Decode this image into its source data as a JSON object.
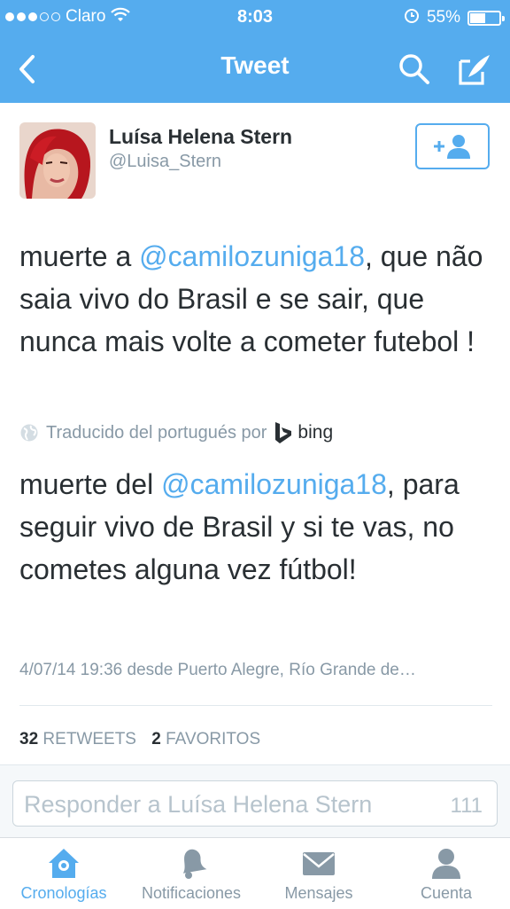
{
  "status_bar": {
    "carrier": "Claro",
    "time": "8:03",
    "battery": "55%",
    "battery_level": 0.55,
    "signal_bars": 3,
    "signal_max": 5
  },
  "nav": {
    "title": "Tweet"
  },
  "tweet": {
    "author_name": "Luísa Helena Stern",
    "author_handle": "@Luisa_Stern",
    "text_before": "muerte a ",
    "mention": "@camilozuniga18",
    "text_after": ", que não saia vivo do Brasil e se sair, que nunca mais volte a cometer futebol !",
    "translation_label": "Traducido del portugués por",
    "translation_provider": "bing",
    "translated_before": "muerte del ",
    "translated_mention": "@camilozuniga18",
    "translated_after": ", para seguir vivo de Brasil y si te vas, no cometes alguna vez fútbol!",
    "meta": "4/07/14 19:36 desde Puerto Alegre, Río Grande de…",
    "retweets_count": "32",
    "retweets_label": "RETWEETS",
    "favorites_count": "2",
    "favorites_label": "FAVORITOS"
  },
  "reply": {
    "placeholder": "Responder a Luísa Helena Stern",
    "char_count": "111"
  },
  "tabs": [
    {
      "label": "Cronologías",
      "icon": "home-icon",
      "active": true
    },
    {
      "label": "Notificaciones",
      "icon": "bell-icon",
      "active": false
    },
    {
      "label": "Mensajes",
      "icon": "envelope-icon",
      "active": false
    },
    {
      "label": "Cuenta",
      "icon": "person-icon",
      "active": false
    }
  ],
  "colors": {
    "accent": "#55acee",
    "text": "#292f33",
    "muted": "#8899a6"
  }
}
